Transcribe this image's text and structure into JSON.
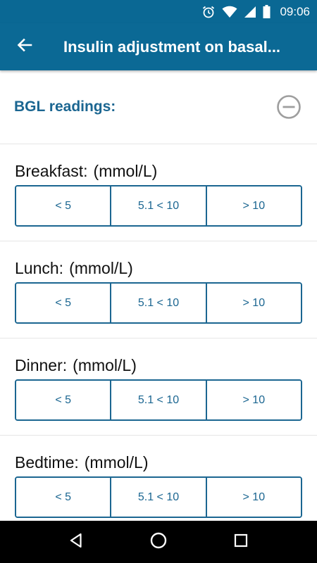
{
  "status_bar": {
    "time": "09:06",
    "icons": [
      "alarm-icon",
      "wifi-icon",
      "signal-icon",
      "battery-icon"
    ]
  },
  "app_bar": {
    "title": "Insulin adjustment on basal...",
    "back_icon": "arrow-left-icon"
  },
  "section": {
    "title": "BGL readings:",
    "collapse_icon": "minus-circle-icon"
  },
  "meals": [
    {
      "name": "Breakfast:",
      "unit": "(mmol/L)",
      "options": [
        "< 5",
        "5.1 < 10",
        "> 10"
      ]
    },
    {
      "name": "Lunch:",
      "unit": "(mmol/L)",
      "options": [
        "< 5",
        "5.1 < 10",
        "> 10"
      ]
    },
    {
      "name": "Dinner:",
      "unit": "(mmol/L)",
      "options": [
        "< 5",
        "5.1 < 10",
        "> 10"
      ]
    },
    {
      "name": "Bedtime:",
      "unit": "(mmol/L)",
      "options": [
        "< 5",
        "5.1 < 10",
        "> 10"
      ]
    }
  ],
  "nav_bar": {
    "icons": [
      "back-triangle-icon",
      "home-circle-icon",
      "recents-square-icon"
    ]
  },
  "colors": {
    "primary": "#0b6995",
    "accent": "#1b6691"
  }
}
